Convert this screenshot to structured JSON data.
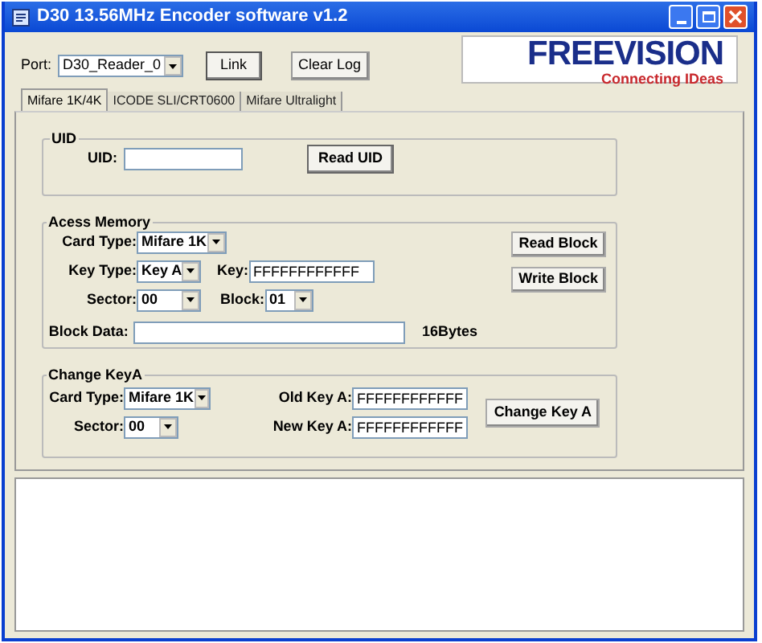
{
  "window": {
    "title": "D30 13.56MHz Encoder software v1.2"
  },
  "toolbar": {
    "port_label": "Port:",
    "port": "D30_Reader_0",
    "link_button": "Link",
    "clear_button": "Clear Log"
  },
  "logo": {
    "name": "FREEVISION",
    "tagline": "Connecting IDeas"
  },
  "tabs": [
    {
      "label": "Mifare 1K/4K",
      "selected": true
    },
    {
      "label": "ICODE SLI/CRT0600",
      "selected": false
    },
    {
      "label": "Mifare Ultralight",
      "selected": false
    }
  ],
  "uid_group": {
    "title": "UID",
    "uid_label": "UID:",
    "read_button": "Read UID"
  },
  "access_memory": {
    "title": "Acess Memory",
    "card_type_label": "Card Type:",
    "card_type": "Mifare 1K",
    "key_type_label": "Key Type:",
    "key_type": "Key A",
    "key_label": "Key:",
    "key": "FFFFFFFFFFFF",
    "sector_label": "Sector:",
    "sector": "00",
    "block_label": "Block:",
    "block": "01",
    "block_data_label": "Block Data:",
    "bytes_note": "16Bytes",
    "read_button": "Read Block",
    "write_button": "Write Block"
  },
  "change_key": {
    "title": "Change KeyA",
    "card_type_label": "Card Type:",
    "card_type": "Mifare 1K",
    "sector_label": "Sector:",
    "sector": "00",
    "old_key_label": "Old Key A:",
    "old_key": "FFFFFFFFFFFF",
    "new_key_label": "New Key A:",
    "new_key": "FFFFFFFFFFFF",
    "change_button": "Change Key A"
  }
}
